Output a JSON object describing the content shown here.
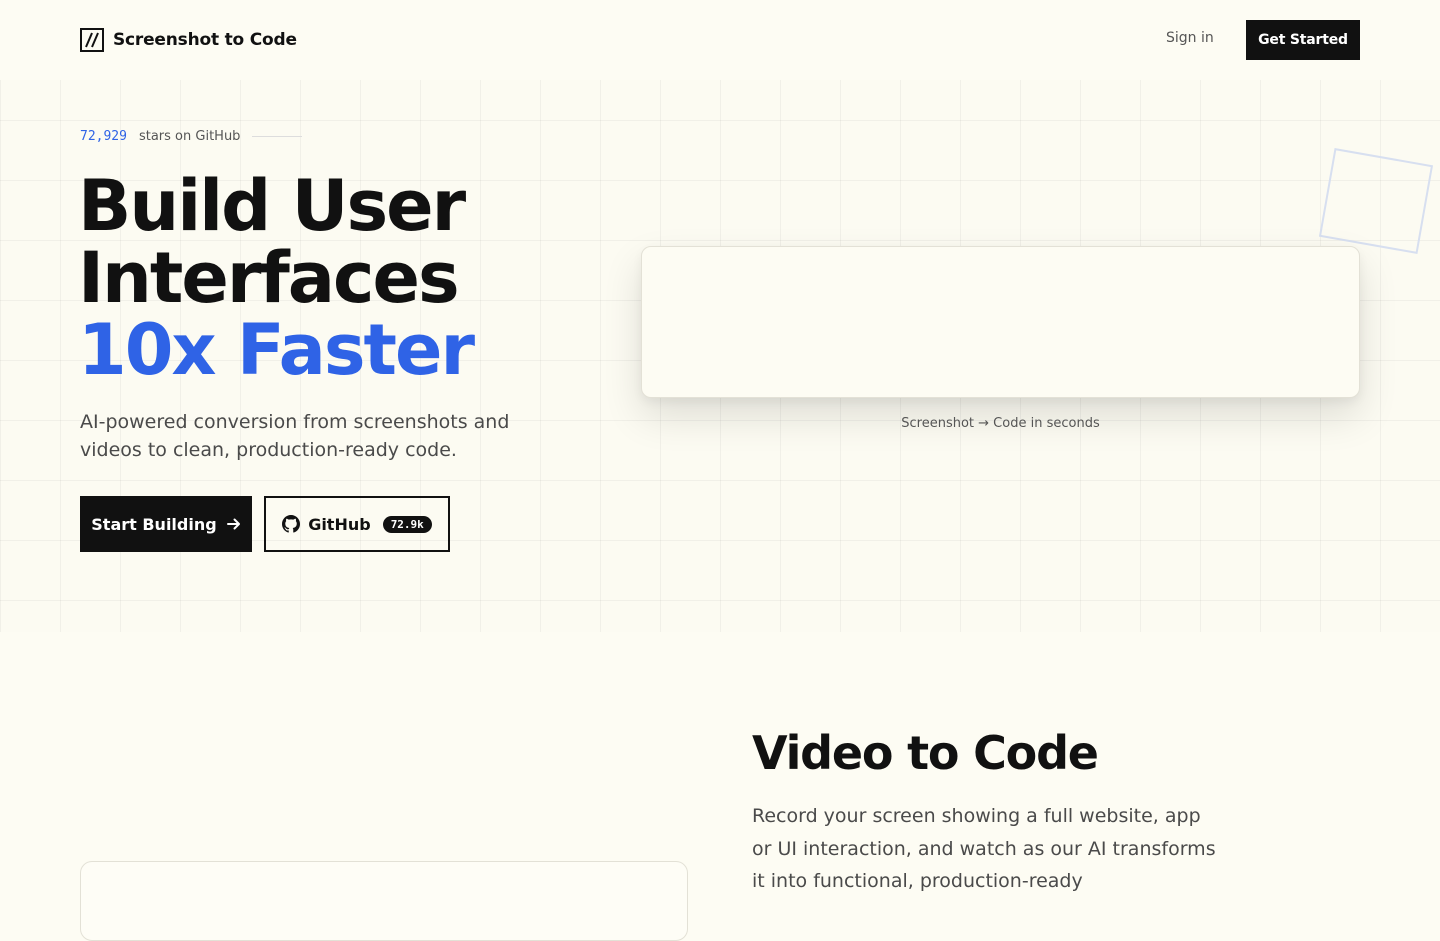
{
  "nav": {
    "brand": "Screenshot to Code",
    "signin": "Sign in",
    "cta": "Get Started"
  },
  "hero": {
    "stars_count": "72,929",
    "stars_label": "stars on GitHub",
    "title_line1": "Build User",
    "title_line2": "Interfaces",
    "title_accent": "10x Faster",
    "subtitle": "AI-powered conversion from screenshots and videos to clean, production-ready code.",
    "primary_button": "Start Building",
    "github_button": "GitHub",
    "github_count": "72.9k",
    "demo_caption": "Screenshot → Code in seconds"
  },
  "section2": {
    "title": "Video to Code",
    "text": "Record your screen showing a full website, app or UI interaction, and watch as our AI transforms it into functional, production-ready"
  },
  "colors": {
    "background": "#fdfcf3",
    "accent": "#2f63e6",
    "ink": "#111111"
  },
  "icons": [
    "logo-slash-icon",
    "arrow-right-icon",
    "github-icon"
  ]
}
